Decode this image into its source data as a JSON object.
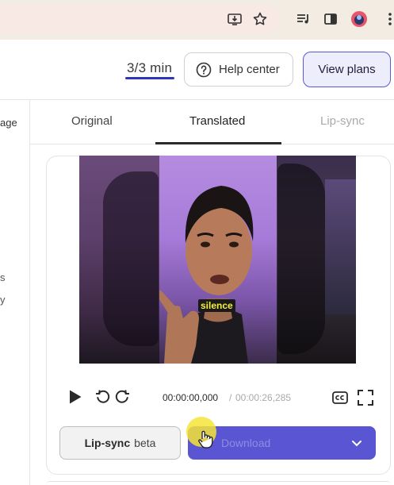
{
  "browser": {
    "icons": [
      "install-app-icon",
      "bookmark-star-icon",
      "media-queue-icon",
      "side-panel-icon",
      "profile-avatar-icon",
      "more-menu-icon"
    ],
    "avatar_color": "#e8546a"
  },
  "header": {
    "usage": "3/3 min",
    "help_label": "Help center",
    "plans_label": "View plans",
    "accent": "#5b58d8"
  },
  "left_panel": {
    "tab_fragment": "age",
    "text_fragments": [
      "s",
      "y"
    ]
  },
  "tabs": [
    {
      "label": "Original",
      "active": false
    },
    {
      "label": "Translated",
      "active": true
    },
    {
      "label": "Lip-sync",
      "active": false,
      "disabled": true
    }
  ],
  "video": {
    "caption": "silence",
    "current_time": "00:00:00,000",
    "separator": "/",
    "total_time": "00:00:26,285"
  },
  "actions": {
    "lipsync_label": "Lip-sync",
    "lipsync_badge": "beta",
    "download_label": "Download",
    "download_color": "#5a55d2"
  }
}
